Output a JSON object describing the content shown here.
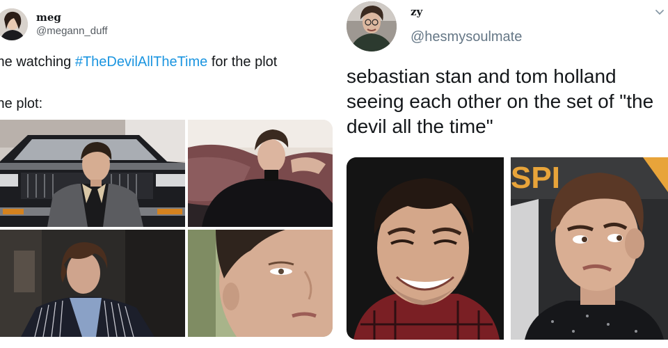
{
  "left_tweet": {
    "display_name": "meg",
    "handle": "@megann_duff",
    "line1_prefix": "me watching ",
    "line1_hashtag": "#TheDevilAllTheTime",
    "line1_suffix": " for the plot",
    "line2": "the plot:",
    "colors": {
      "hashtag": "#1b95e0",
      "handle": "#555b61"
    }
  },
  "right_tweet": {
    "display_name": "zy",
    "handle": "@hesmysoulmate",
    "text": "sebastian stan and tom holland seeing each other on the set of \"the devil all the time\"",
    "menu_icon": "chevron-down-icon",
    "poster_text": "SPI",
    "colors": {
      "handle": "#657786"
    }
  }
}
